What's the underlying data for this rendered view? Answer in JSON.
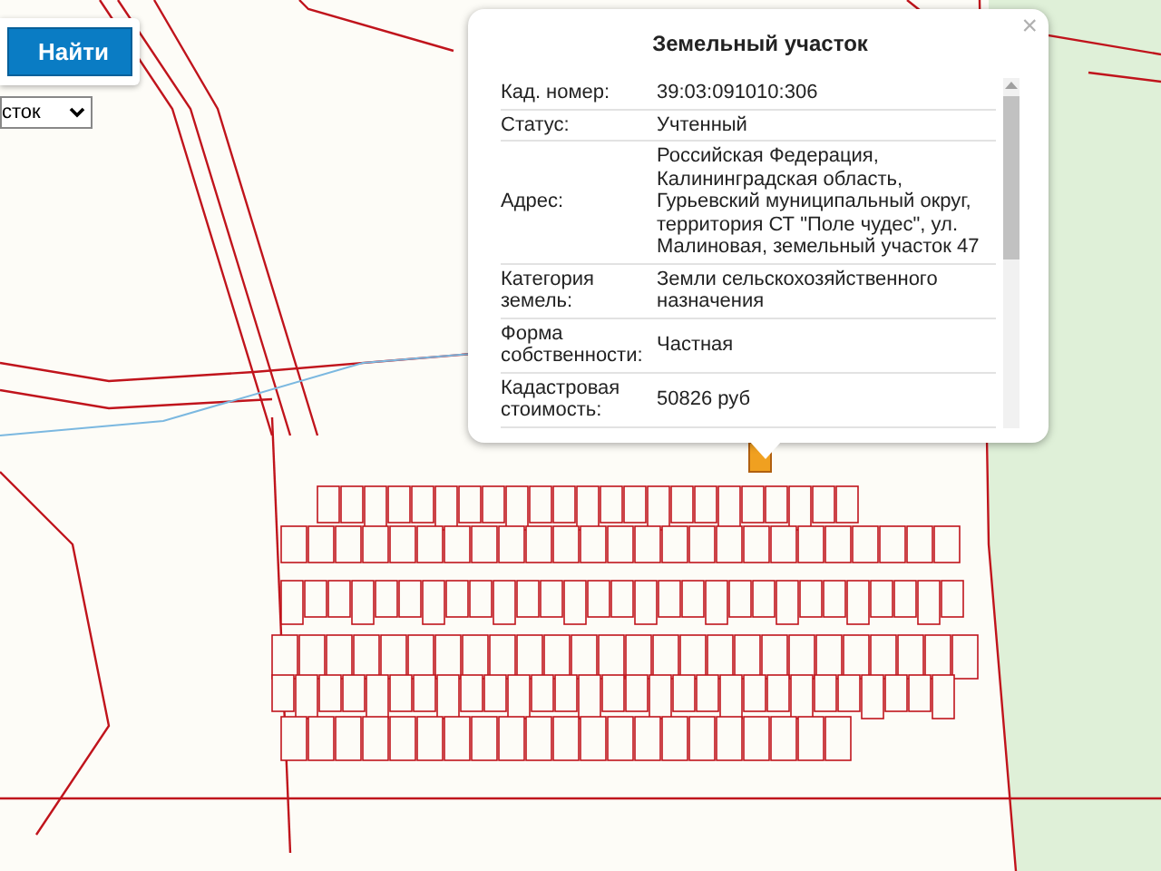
{
  "search_button": "Найти",
  "type_select": {
    "value": "сток"
  },
  "popup": {
    "title": "Земельный участок",
    "close": "×",
    "rows": [
      {
        "label": "Кад. номер:",
        "value": "39:03:091010:306"
      },
      {
        "label": "Статус:",
        "value": "Учтенный"
      },
      {
        "label": "Адрес:",
        "value": "Российская Федерация, Калининградская область, Гурьевский муниципальный округ, территория СТ \"Поле чудес\", ул. Малиновая, земельный участок 47"
      },
      {
        "label": "Категория земель:",
        "value": "Земли сельскохозяйственного назначения"
      },
      {
        "label": "Форма собственности:",
        "value": "Частная"
      },
      {
        "label": "Кадастровая стоимость:",
        "value": "50826 руб"
      }
    ]
  }
}
